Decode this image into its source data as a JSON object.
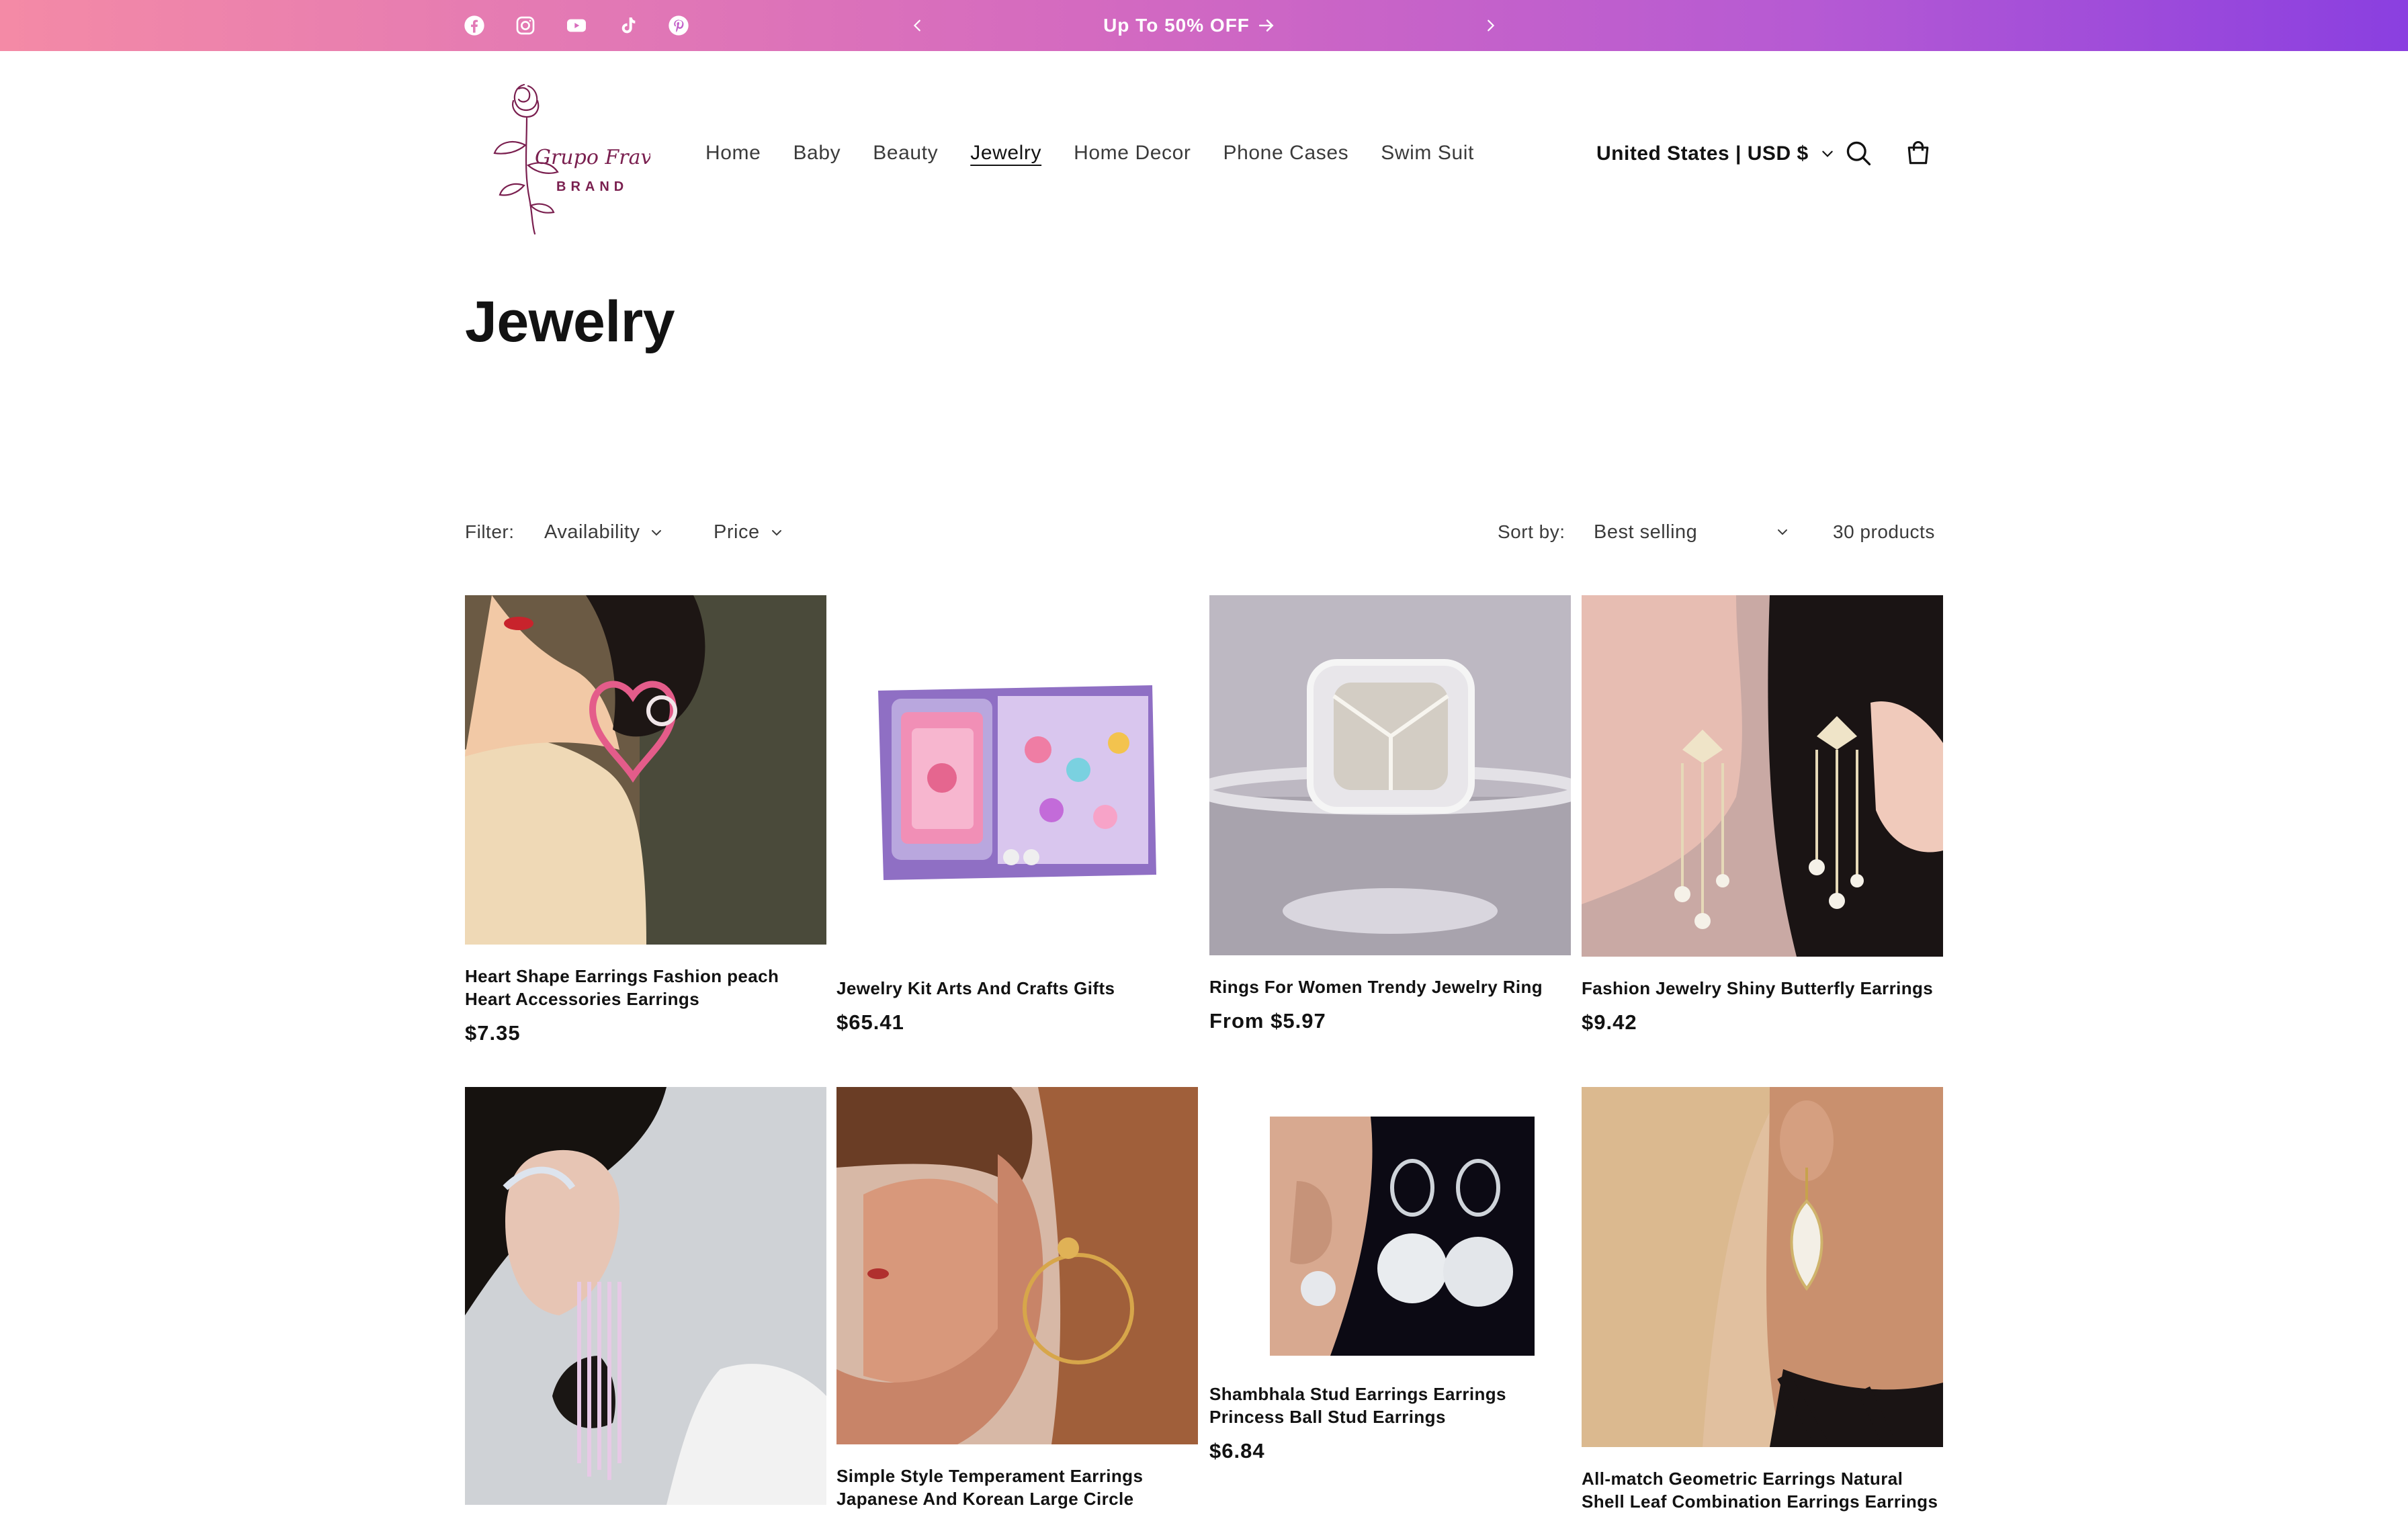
{
  "announcement": {
    "text": "Up To 50% OFF",
    "social_icons": [
      "facebook-icon",
      "instagram-icon",
      "youtube-icon",
      "tiktok-icon",
      "pinterest-icon"
    ]
  },
  "header": {
    "logo_script": "Grupo Fravas",
    "logo_brand": "BRAND",
    "nav": [
      "Home",
      "Baby",
      "Beauty",
      "Jewelry",
      "Home Decor",
      "Phone Cases",
      "Swim Suit"
    ],
    "active_nav": "Jewelry",
    "country": "United States | USD $"
  },
  "page": {
    "title": "Jewelry"
  },
  "filters": {
    "label": "Filter:",
    "availability": "Availability",
    "price": "Price",
    "sort_label": "Sort by:",
    "sort_value": "Best selling",
    "count": "30 products"
  },
  "products": [
    {
      "title": "Heart Shape Earrings Fashion peach Heart Accessories Earrings",
      "price": "$7.35"
    },
    {
      "title": "Jewelry Kit Arts And Crafts Gifts",
      "price": "$65.41"
    },
    {
      "title": "Rings For Women Trendy Jewelry Ring",
      "price": "From $5.97"
    },
    {
      "title": "Fashion Jewelry Shiny Butterfly Earrings",
      "price": "$9.42"
    },
    {
      "title": "",
      "price": ""
    },
    {
      "title": "Simple Style Temperament Earrings Japanese And Korean Large Circle",
      "price": ""
    },
    {
      "title": "Shambhala Stud Earrings Earrings Princess Ball Stud Earrings",
      "price": "$6.84"
    },
    {
      "title": "All-match Geometric Earrings Natural Shell Leaf Combination Earrings Earrings",
      "price": ""
    }
  ],
  "colors": {
    "gradient_start": "#f48aa6",
    "gradient_end": "#8a3fe0",
    "text": "#121212",
    "muted": "#3b3b3b",
    "logo": "#7a1f4f"
  }
}
